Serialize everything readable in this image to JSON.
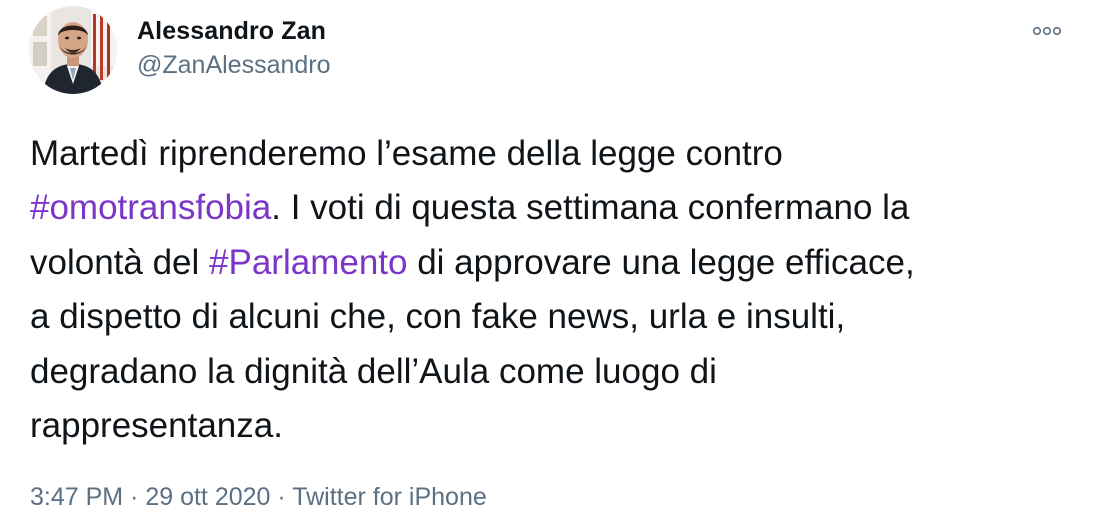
{
  "author": {
    "display_name": "Alessandro Zan",
    "handle": "@ZanAlessandro",
    "avatar_icon": "profile-photo"
  },
  "menu": {
    "icon": "more-options-icon"
  },
  "tweet": {
    "line1": "Martedì riprenderemo l’esame della legge contro",
    "hashtag1": "#omotransfobia",
    "line2_rest": ". I voti di questa settimana confermano la",
    "line3_pre": "volontà del ",
    "hashtag2": "#Parlamento",
    "line3_post": " di approvare una legge efficace,",
    "line4": "a dispetto di alcuni che, con fake news, urla e insulti,",
    "line5": "degradano la dignità dell’Aula come luogo di",
    "line6": "rappresentanza."
  },
  "meta": {
    "time": "3:47 PM",
    "sep1": " · ",
    "date": "29 ott 2020",
    "sep2": " · ",
    "source": "Twitter for iPhone"
  },
  "colors": {
    "text": "#0f1419",
    "secondary": "#5b7083",
    "link": "#7b36c7"
  }
}
